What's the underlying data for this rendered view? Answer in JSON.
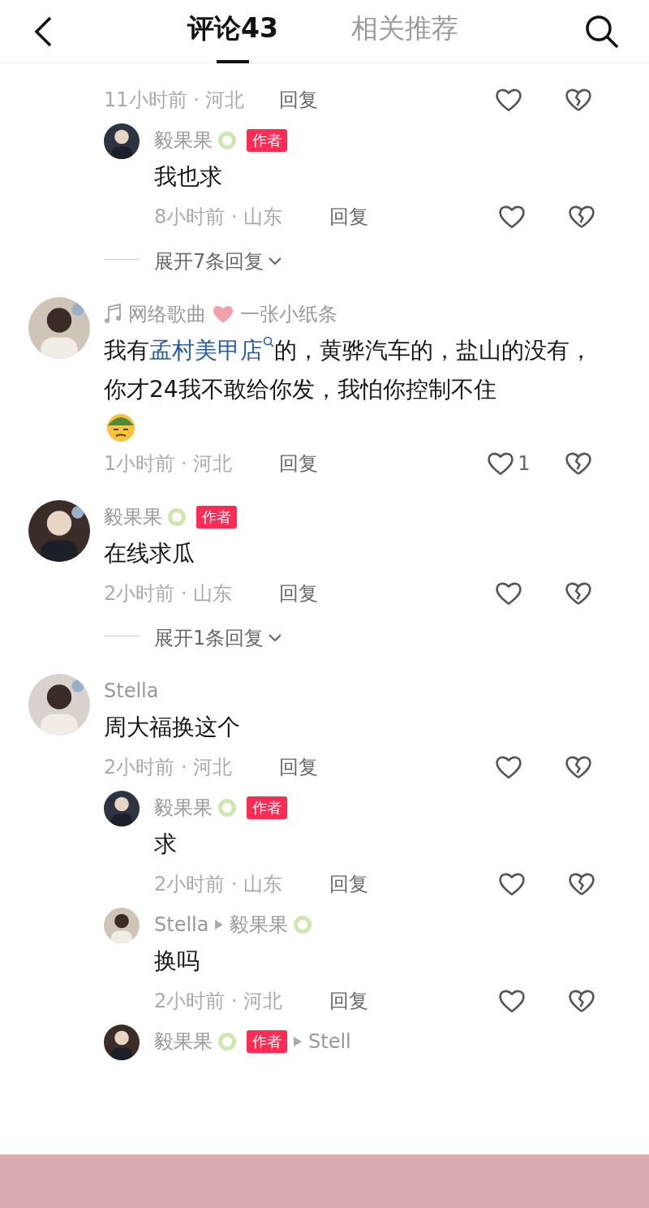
{
  "header": {
    "tabs": [
      {
        "label": "评论43",
        "selected": true
      },
      {
        "label": "相关推荐",
        "selected": false
      }
    ]
  },
  "comments": [
    {
      "kind": "top",
      "meta": "11小时前 · 河北",
      "reply": "回复"
    },
    {
      "kind": "reply",
      "name": "毅果果",
      "medal": true,
      "badge": "作者",
      "text": [
        {
          "kind": "text",
          "value": "我也求"
        }
      ],
      "meta": "8小时前 · 山东",
      "reply": "回复",
      "expand": "展开7条回复"
    },
    {
      "kind": "top",
      "music": true,
      "name": "网络歌曲",
      "name_suffix": "一张小纸条",
      "text": [
        {
          "kind": "text",
          "value": "我有"
        },
        {
          "kind": "link",
          "value": "孟村美甲店"
        },
        {
          "kind": "text",
          "value": "的，黄骅汽车的，盐山的没有，你才24我不敢给你发，我怕你控制不住"
        }
      ],
      "emoji": true,
      "meta": "1小时前 · 河北",
      "reply": "回复",
      "likes": "1"
    },
    {
      "kind": "top",
      "name": "毅果果",
      "medal": true,
      "badge": "作者",
      "text": [
        {
          "kind": "text",
          "value": "在线求瓜"
        }
      ],
      "meta": "2小时前 · 山东",
      "reply": "回复",
      "expand": "展开1条回复"
    },
    {
      "kind": "top",
      "name": "Stella",
      "text": [
        {
          "kind": "text",
          "value": "周大福换这个"
        }
      ],
      "meta": "2小时前 · 河北",
      "reply": "回复"
    },
    {
      "kind": "reply",
      "name": "毅果果",
      "medal": true,
      "badge": "作者",
      "text": [
        {
          "kind": "text",
          "value": "求"
        }
      ],
      "meta": "2小时前 · 山东",
      "reply": "回复"
    },
    {
      "kind": "reply",
      "name": "Stella",
      "target": "毅果果",
      "target_medal": true,
      "text": [
        {
          "kind": "text",
          "value": "换吗"
        }
      ],
      "meta": "2小时前 · 河北",
      "reply": "回复"
    },
    {
      "kind": "reply",
      "name": "毅果果",
      "medal": true,
      "badge": "作者",
      "target": "Stell"
    }
  ]
}
